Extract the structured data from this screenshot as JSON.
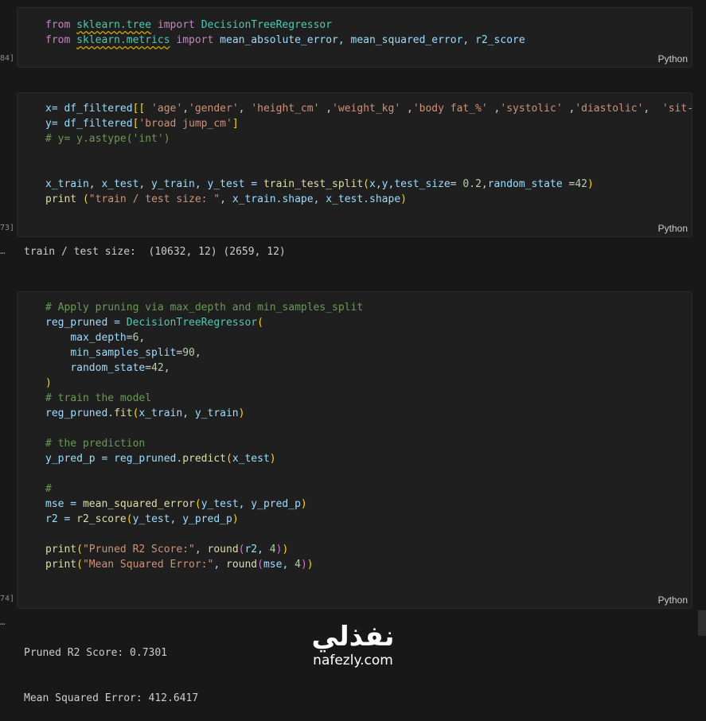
{
  "cell1": {
    "exec_count": "84]",
    "language": "Python",
    "code": {
      "l1_from": "from",
      "l1_module": "sklearn.tree",
      "l1_import": "import",
      "l1_name": "DecisionTreeRegressor",
      "l2_from": "from",
      "l2_module": "sklearn.metrics",
      "l2_import": "import",
      "l2_names": "mean_absolute_error, mean_squared_error, r2_score"
    }
  },
  "cell2": {
    "exec_count": "73]",
    "language": "Python",
    "code": {
      "l1_a": "x= df_filtered",
      "l1_b1": "[[",
      "l1_s1": " 'age'",
      "l1_c1": ",",
      "l1_s2": "'gender'",
      "l1_c2": ", ",
      "l1_s3": "'height_cm'",
      "l1_c3": " ,",
      "l1_s4": "'weight_kg'",
      "l1_c4": " ,",
      "l1_s5": "'body fat_%'",
      "l1_c5": " ,",
      "l1_s6": "'systolic'",
      "l1_c6": " ,",
      "l1_s7": "'diastolic'",
      "l1_c7": ",  ",
      "l1_s8": "'sit-ups counts'",
      "l2_a": "y= df_filtered",
      "l2_b1": "[",
      "l2_s": "'broad jump_cm'",
      "l2_b2": "]",
      "l3": "# y= y.astype('int')",
      "l6_a": "x_train, x_test, y_train, y_test = ",
      "l6_fn": "train_test_split",
      "l6_b1": "(",
      "l6_args": "x,y,",
      "l6_k1": "test_size",
      "l6_eq1": "= ",
      "l6_v1": "0.2",
      "l6_c": ",",
      "l6_k2": "random_state",
      "l6_eq2": " =",
      "l6_v2": "42",
      "l6_b2": ")",
      "l7_fn": "print",
      "l7_sp": " ",
      "l7_b1": "(",
      "l7_s": "\"train / test size: \"",
      "l7_rest": ", x_train.shape, x_test.shape",
      "l7_b2": ")"
    }
  },
  "output1": {
    "text": "train / test size:  (10632, 12) (2659, 12)"
  },
  "cell3": {
    "exec_count": "74]",
    "language": "Python",
    "code": {
      "l1": "# Apply pruning via max_depth and min_samples_split",
      "l2_a": "reg_pruned = ",
      "l2_cls": "DecisionTreeRegressor",
      "l2_b": "(",
      "l3_k": "max_depth",
      "l3_eq": "=",
      "l3_v": "6",
      "l3_c": ",",
      "l4_k": "min_samples_split",
      "l4_eq": "=",
      "l4_v": "90",
      "l4_c": ",",
      "l5_k": "random_state",
      "l5_eq": "=",
      "l5_v": "42",
      "l5_c": ",",
      "l6": ")",
      "l7": "# train the model",
      "l8_a": "reg_pruned.",
      "l8_fn": "fit",
      "l8_b1": "(",
      "l8_args": "x_train, y_train",
      "l8_b2": ")",
      "l10": "# the prediction",
      "l11_a": "y_pred_p = reg_pruned.",
      "l11_fn": "predict",
      "l11_b1": "(",
      "l11_args": "x_test",
      "l11_b2": ")",
      "l13": "#",
      "l14_a": "mse = ",
      "l14_fn": "mean_squared_error",
      "l14_b1": "(",
      "l14_args": "y_test, y_pred_p",
      "l14_b2": ")",
      "l15_a": "r2 = ",
      "l15_fn": "r2_score",
      "l15_b1": "(",
      "l15_args": "y_test, y_pred_p",
      "l15_b2": ")",
      "l17_fn": "print",
      "l17_b1": "(",
      "l17_s": "\"Pruned R2 Score:\"",
      "l17_c": ", ",
      "l17_fn2": "round",
      "l17_b2": "(",
      "l17_args": "r2, ",
      "l17_v": "4",
      "l17_b3": ")",
      "l17_b4": ")",
      "l18_fn": "print",
      "l18_b1": "(",
      "l18_s": "\"Mean Squared Error:\"",
      "l18_c": ", ",
      "l18_fn2": "round",
      "l18_b2": "(",
      "l18_args": "mse, ",
      "l18_v": "4",
      "l18_b3": ")",
      "l18_b4": ")"
    }
  },
  "output2": {
    "line1": "Pruned R2 Score: 0.7301",
    "line2": "Mean Squared Error: 412.6417"
  },
  "watermark": {
    "arabic": "نفذلي",
    "latin": "nafezly.com"
  }
}
